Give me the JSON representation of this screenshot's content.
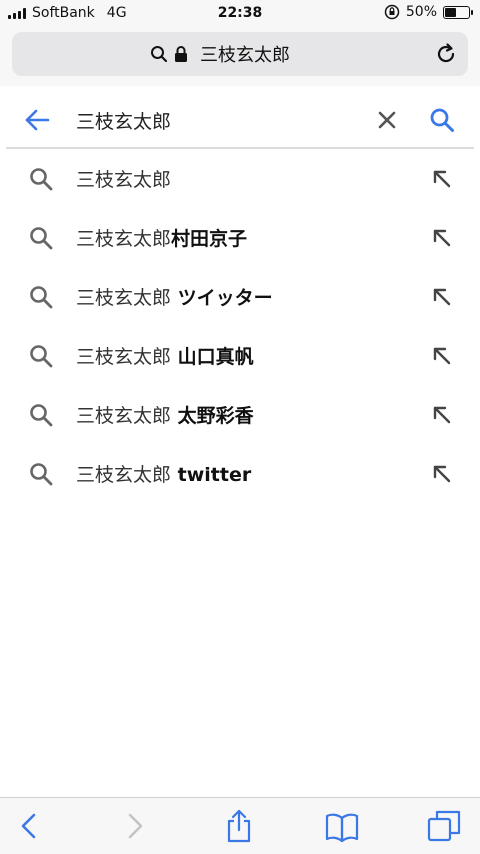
{
  "status_bar": {
    "carrier": "SoftBank",
    "network": "4G",
    "time": "22:38",
    "battery": "50%",
    "battery_level": 0.5
  },
  "address_bar": {
    "title": "三枝玄太郎",
    "icons": [
      "search-icon",
      "lock-icon",
      "reload-icon"
    ]
  },
  "search": {
    "query": "三枝玄太郎",
    "accent": "#3b78e7"
  },
  "suggestions": [
    {
      "prefix": "三枝玄太郎",
      "bold": ""
    },
    {
      "prefix": "三枝玄太郎",
      "bold": "村田京子"
    },
    {
      "prefix": "三枝玄太郎",
      "bold": " ツイッター"
    },
    {
      "prefix": "三枝玄太郎",
      "bold": " 山口真帆"
    },
    {
      "prefix": "三枝玄太郎",
      "bold": " 太野彩香"
    },
    {
      "prefix": "三枝玄太郎",
      "bold": " twitter"
    }
  ],
  "toolbar": {
    "accent": "#3b78e7",
    "icons": [
      "back-icon",
      "forward-icon",
      "share-icon",
      "bookmarks-icon",
      "tabs-icon"
    ]
  }
}
